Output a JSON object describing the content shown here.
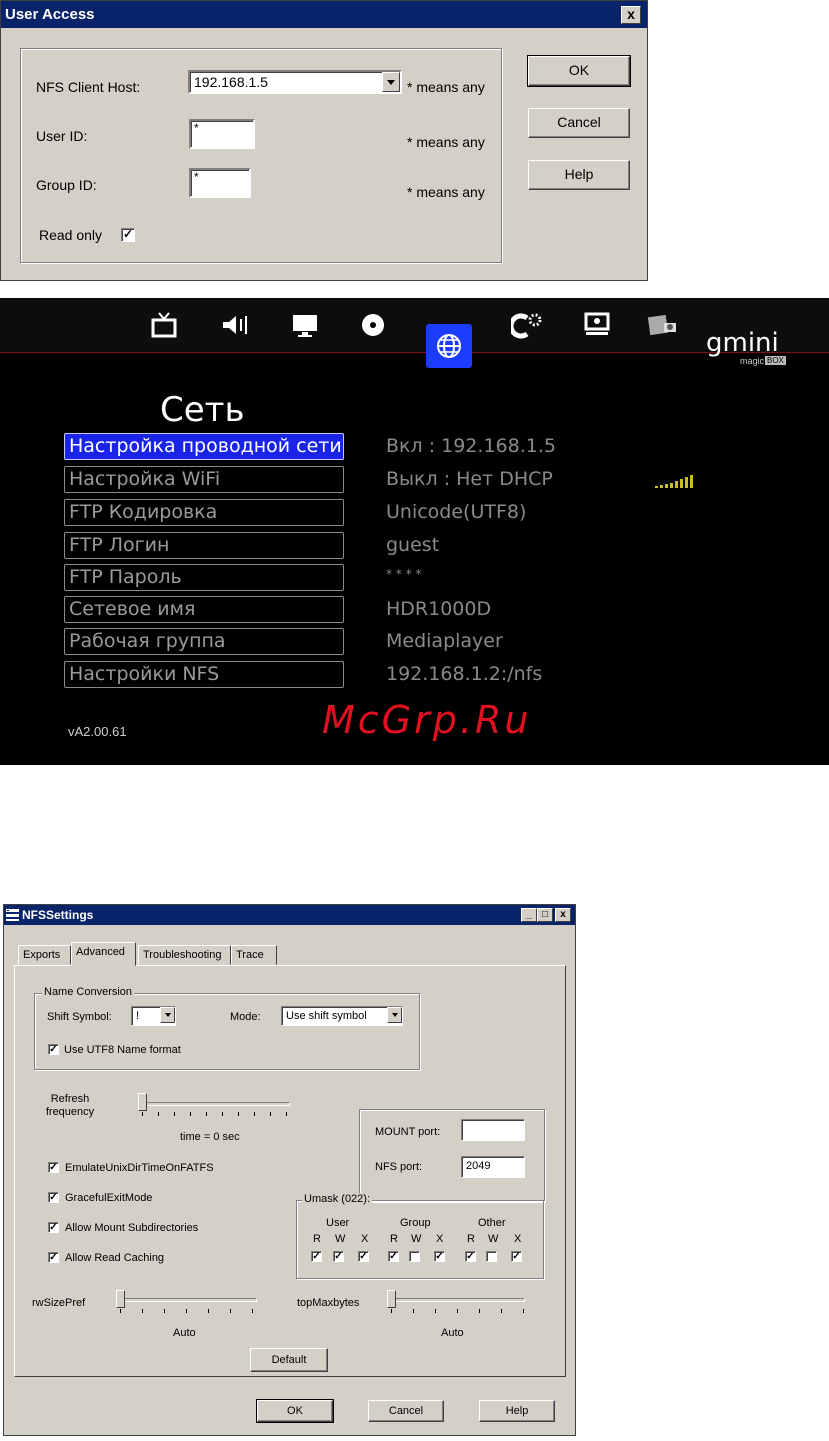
{
  "user_access": {
    "title": "User Access",
    "close_glyph": "x",
    "host_label": "NFS Client Host:",
    "host_value": "192.168.1.5",
    "host_hint": "* means any",
    "user_label": "User ID:",
    "user_value": "*",
    "user_hint": "* means any",
    "group_label": "Group ID:",
    "group_value": "*",
    "group_hint": "* means any",
    "readonly_label": "Read only",
    "readonly_checked": true,
    "ok": "OK",
    "cancel": "Cancel",
    "help": "Help"
  },
  "tv_menu": {
    "title": "Сеть",
    "logo": "gmini",
    "logo_sub": "magic",
    "logo_box": "BOX",
    "icons": [
      "tv-icon",
      "speaker-icon",
      "monitor-icon",
      "disc-icon",
      "globe-icon",
      "gear-icon",
      "screen-settings-icon",
      "photo-icon"
    ],
    "items": [
      {
        "label": "Настройка проводной сети",
        "value": "Вкл : 192.168.1.5",
        "selected": true
      },
      {
        "label": "Настройка WiFi",
        "value": "Выкл : Нет DHCP"
      },
      {
        "label": "FTP Кодировка",
        "value": "Unicode(UTF8)"
      },
      {
        "label": "FTP Логин",
        "value": "guest"
      },
      {
        "label": "FTP Пароль",
        "value": "* * * *"
      },
      {
        "label": "Сетевое имя",
        "value": "HDR1000D"
      },
      {
        "label": "Рабочая группа",
        "value": "Mediaplayer"
      },
      {
        "label": "Настройки NFS",
        "value": "192.168.1.2:/nfs"
      }
    ],
    "version": "vA2.00.61",
    "watermark": "McGrp.Ru"
  },
  "nfs": {
    "title": "NFSSettings",
    "tabs": [
      "Exports",
      "Advanced",
      "Troubleshooting",
      "Trace"
    ],
    "name_conversion": "Name Conversion",
    "shift_symbol_label": "Shift Symbol:",
    "shift_symbol_value": "!",
    "mode_label": "Mode:",
    "mode_value": "Use shift symbol",
    "utf8_label": "Use UTF8 Name format",
    "refresh_label": "Refresh frequency",
    "refresh_value": "time = 0 sec",
    "mount_port_label": "MOUNT port:",
    "mount_port_value": "",
    "nfs_port_label": "NFS port:",
    "nfs_port_value": "2049",
    "opt_emulate": "EmulateUnixDirTimeOnFATFS",
    "opt_graceful": "GracefulExitMode",
    "opt_mount_sub": "Allow Mount Subdirectories",
    "opt_read_cache": "Allow Read Caching",
    "umask_title": "Umask (022):",
    "umask_user": "User",
    "umask_group": "Group",
    "umask_other": "Other",
    "r": "R",
    "w": "W",
    "x": "X",
    "umask_checks": [
      true,
      true,
      true,
      true,
      false,
      true,
      true,
      false,
      true
    ],
    "rwsize_label": "rwSizePref",
    "rwsize_value": "Auto",
    "topmax_label": "topMaxbytes",
    "topmax_value": "Auto",
    "default_btn": "Default",
    "ok": "OK",
    "cancel": "Cancel",
    "help": "Help",
    "min_glyph": "_",
    "max_glyph": "□",
    "close_glyph": "x",
    "check_glyph": "✓"
  }
}
